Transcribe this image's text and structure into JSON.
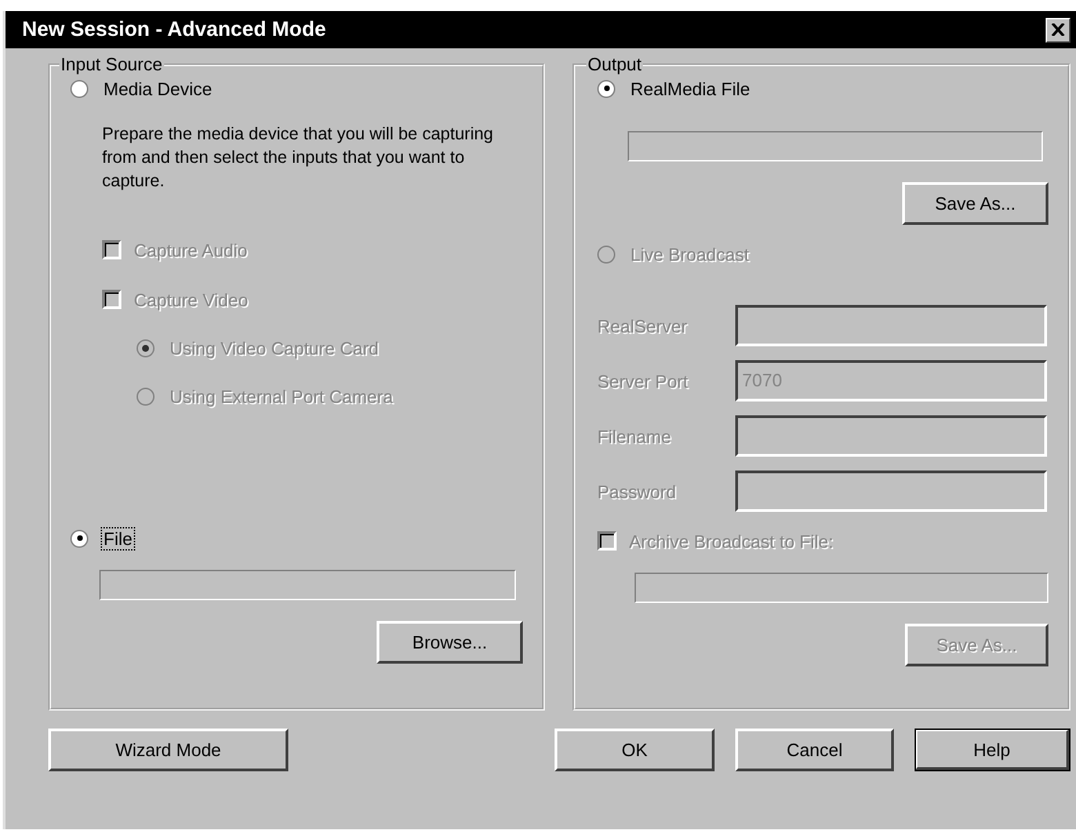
{
  "window": {
    "title": "New Session - Advanced Mode"
  },
  "input_source": {
    "title": "Input Source",
    "media_device": {
      "label": "Media Device",
      "selected": false,
      "disabled": false
    },
    "description": "Prepare the media device that you will be capturing from and then select the inputs that you want to capture.",
    "captures": [
      {
        "label": "Capture Audio",
        "checked": false,
        "disabled": true
      },
      {
        "label": "Capture Video",
        "checked": false,
        "disabled": true
      }
    ],
    "video_sources": [
      {
        "label": "Using Video Capture Card",
        "selected": true,
        "disabled": true
      },
      {
        "label": "Using External Port Camera",
        "selected": false,
        "disabled": true
      }
    ],
    "file": {
      "label": "File",
      "selected": true,
      "disabled": false,
      "focused": true
    },
    "browse_button": {
      "label": "Browse...",
      "disabled": false
    }
  },
  "output": {
    "title": "Output",
    "realmedia_file": {
      "label": "RealMedia File",
      "selected": true,
      "disabled": false
    },
    "save_as_button": {
      "label": "Save As...",
      "disabled": false
    },
    "live_broadcast": {
      "label": "Live Broadcast",
      "selected": false,
      "disabled": true
    },
    "server_fields": [
      {
        "label": "RealServer"
      },
      {
        "label": "Server Port",
        "value": "7070"
      },
      {
        "label": "Filename"
      },
      {
        "label": "Password"
      }
    ],
    "archive": {
      "label": "Archive Broadcast to File:",
      "checked": false,
      "disabled": true
    },
    "archive_save_as_button": {
      "label": "Save As...",
      "disabled": true
    }
  },
  "buttons": [
    {
      "label": "Wizard Mode",
      "default": false
    },
    {
      "label": "OK",
      "default": false
    },
    {
      "label": "Cancel",
      "default": false
    },
    {
      "label": "Help",
      "default": true
    }
  ]
}
